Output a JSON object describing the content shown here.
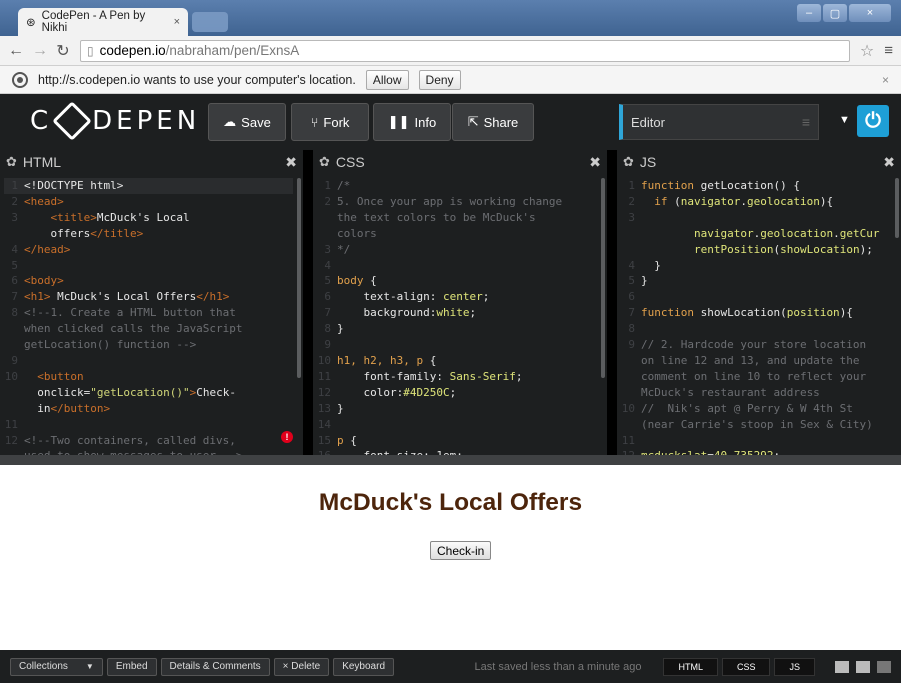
{
  "browser": {
    "tab_title": "CodePen - A Pen by Nikhi",
    "tab_close": "×",
    "window_buttons": [
      "–",
      "▢",
      "×"
    ],
    "url_host": "codepen.io",
    "url_path": "/nabraham/pen/ExnsA",
    "infobar": {
      "message": "http://s.codepen.io wants to use your computer's location.",
      "allow": "Allow",
      "deny": "Deny",
      "close": "×"
    }
  },
  "header": {
    "logo": "C⊛DEPEN",
    "save": "Save",
    "fork": "Fork",
    "info": "Info",
    "share": "Share",
    "editor_select": "Editor"
  },
  "panels": {
    "html": {
      "title": "HTML"
    },
    "css": {
      "title": "CSS"
    },
    "js": {
      "title": "JS"
    }
  },
  "result": {
    "heading": "McDuck's Local Offers",
    "button": "Check-in"
  },
  "footer": {
    "collections": "Collections",
    "embed": "Embed",
    "details": "Details & Comments",
    "delete": "× Delete",
    "keyboard": "Keyboard",
    "saved": "Last saved less than a minute ago",
    "view_html": "HTML",
    "view_css": "CSS",
    "view_js": "JS"
  },
  "colors": {
    "accent_blue": "#1e9fd6",
    "result_heading": "#4D250C",
    "editor_bg": "#1d1f20"
  }
}
